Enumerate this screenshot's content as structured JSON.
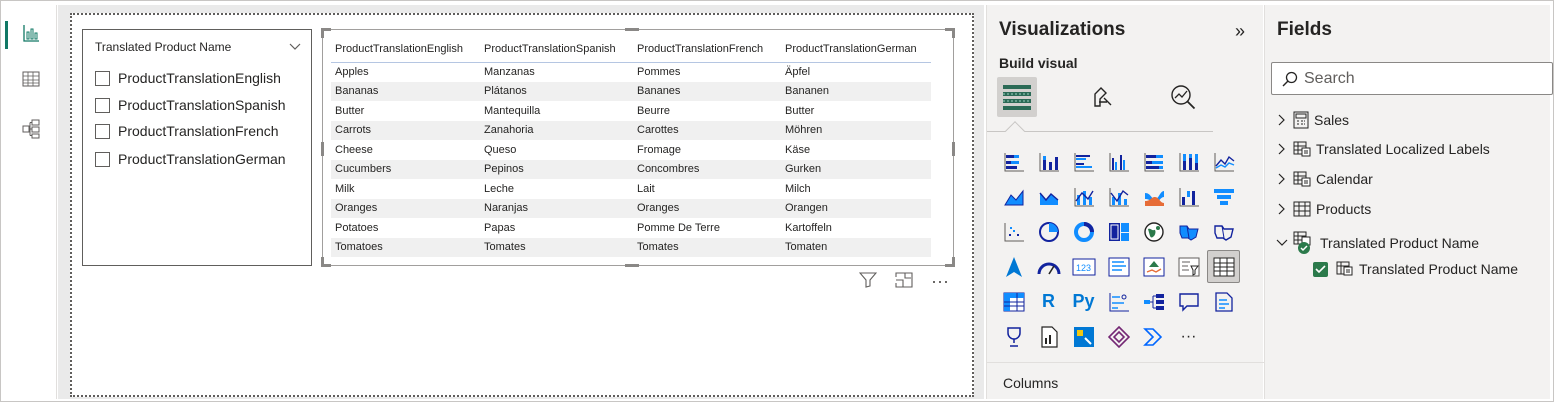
{
  "rail": {
    "items": [
      {
        "name": "report-view",
        "active": true
      },
      {
        "name": "table-view",
        "active": false
      },
      {
        "name": "model-view",
        "active": false
      }
    ]
  },
  "slicer": {
    "title": "Translated Product Name",
    "items": [
      "ProductTranslationEnglish",
      "ProductTranslationSpanish",
      "ProductTranslationFrench",
      "ProductTranslationGerman"
    ]
  },
  "table": {
    "headers": [
      "ProductTranslationEnglish",
      "ProductTranslationSpanish",
      "ProductTranslationFrench",
      "ProductTranslationGerman"
    ],
    "rows": [
      [
        "Apples",
        "Manzanas",
        "Pommes",
        "Äpfel"
      ],
      [
        "Bananas",
        "Plátanos",
        "Bananes",
        "Bananen"
      ],
      [
        "Butter",
        "Mantequilla",
        "Beurre",
        "Butter"
      ],
      [
        "Carrots",
        "Zanahoria",
        "Carottes",
        "Möhren"
      ],
      [
        "Cheese",
        "Queso",
        "Fromage",
        "Käse"
      ],
      [
        "Cucumbers",
        "Pepinos",
        "Concombres",
        "Gurken"
      ],
      [
        "Milk",
        "Leche",
        "Lait",
        "Milch"
      ],
      [
        "Oranges",
        "Naranjas",
        "Oranges",
        "Orangen"
      ],
      [
        "Potatoes",
        "Papas",
        "Pomme De Terre",
        "Kartoffeln"
      ],
      [
        "Tomatoes",
        "Tomates",
        "Tomates",
        "Tomaten"
      ]
    ],
    "actions": {
      "more": "⋯"
    }
  },
  "visualizations": {
    "title": "Visualizations",
    "collapse_glyph": "»",
    "build_label": "Build visual",
    "build_tabs": [
      "build-visual-icon",
      "format-visual-icon",
      "analytics-icon"
    ],
    "icons": [
      "stacked-bar-chart-icon",
      "stacked-column-chart-icon",
      "clustered-bar-chart-icon",
      "clustered-column-chart-icon",
      "100-stacked-bar-chart-icon",
      "100-stacked-column-chart-icon",
      "line-chart-icon",
      "area-chart-icon",
      "stacked-area-chart-icon",
      "line-clustered-column-chart-icon",
      "line-stacked-column-chart-icon",
      "ribbon-chart-icon",
      "waterfall-chart-icon",
      "funnel-chart-icon",
      "scatter-chart-icon",
      "pie-chart-icon",
      "donut-chart-icon",
      "treemap-icon",
      "map-icon",
      "filled-map-icon",
      "shape-map-icon",
      "azure-map-icon",
      "gauge-icon",
      "card-icon",
      "multi-row-card-icon",
      "kpi-icon",
      "slicer-icon",
      "table-icon",
      "matrix-icon",
      "r-visual-icon",
      "python-visual-icon",
      "key-influencers-icon",
      "decomposition-tree-icon",
      "qa-icon",
      "smart-narrative-icon",
      "metrics-icon",
      "paginated-report-icon",
      "power-apps-icon",
      "power-automate-icon",
      "power-automate-flow-icon",
      "more-visuals-icon"
    ],
    "r_label": "R",
    "py_label": "Py",
    "more_label": "···",
    "columns_label": "Columns"
  },
  "fields": {
    "title": "Fields",
    "search_placeholder": "Search",
    "tables": [
      {
        "label": "Sales",
        "expanded": false
      },
      {
        "label": "Translated Localized Labels",
        "expanded": false
      },
      {
        "label": "Calendar",
        "expanded": false
      },
      {
        "label": "Products",
        "expanded": false
      },
      {
        "label": "Translated Product Name",
        "expanded": true
      }
    ],
    "child_field": "Translated Product Name"
  },
  "colors": {
    "accent": "#117865",
    "viz_blue": "#118dff",
    "viz_dark": "#12239e",
    "check_green": "#2b7a4b"
  }
}
